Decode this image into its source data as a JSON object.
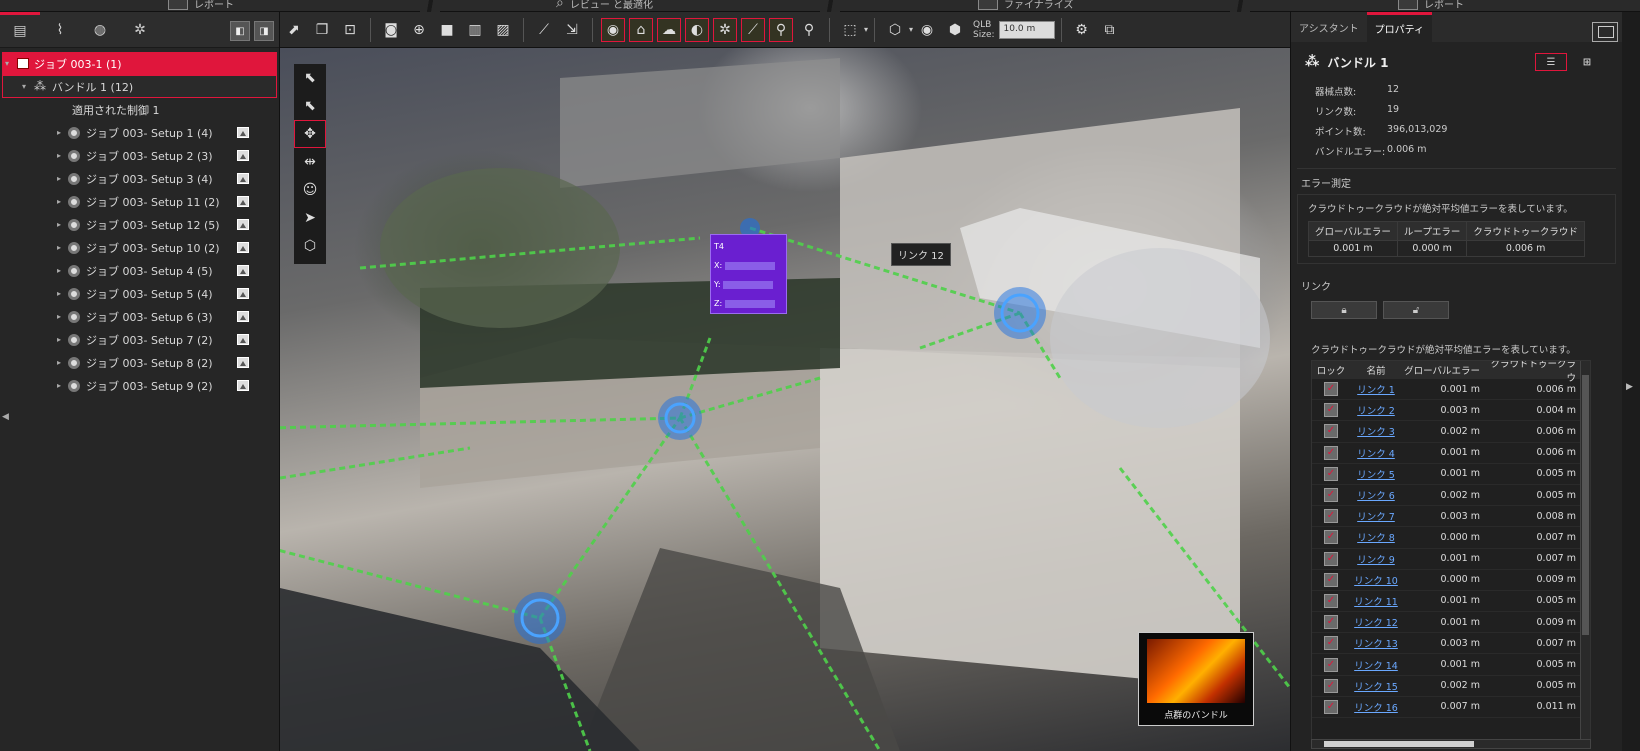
{
  "ribbon": {
    "items": [
      {
        "label": "レポート"
      },
      {
        "label": "レビュー と最適化"
      },
      {
        "label": "ファイナライズ"
      },
      {
        "label": "レポート"
      }
    ]
  },
  "left_panel": {
    "tree": {
      "job": {
        "label": "ジョブ 003-1 (1)"
      },
      "bundle": {
        "label": "バンドル 1 (12)"
      },
      "constraints": {
        "label": "適用された制御 1"
      },
      "setups": [
        {
          "label": "ジョブ 003- Setup 1 (4)"
        },
        {
          "label": "ジョブ 003- Setup 2 (3)"
        },
        {
          "label": "ジョブ 003- Setup 3 (4)"
        },
        {
          "label": "ジョブ 003- Setup 11 (2)"
        },
        {
          "label": "ジョブ 003- Setup 12 (5)"
        },
        {
          "label": "ジョブ 003- Setup 10 (2)"
        },
        {
          "label": "ジョブ 003- Setup 4 (5)"
        },
        {
          "label": "ジョブ 003- Setup 5 (4)"
        },
        {
          "label": "ジョブ 003- Setup 6 (3)"
        },
        {
          "label": "ジョブ 003- Setup 7 (2)"
        },
        {
          "label": "ジョブ 003- Setup 8 (2)"
        },
        {
          "label": "ジョブ 003- Setup 9 (2)"
        }
      ]
    }
  },
  "toolbar": {
    "qlb_label_1": "QLB",
    "qlb_label_2": "Size:",
    "qlb_value": "10.0 m"
  },
  "viewport": {
    "target_card": {
      "title": "T4",
      "x_label": "X:",
      "y_label": "Y:",
      "z_label": "Z:"
    },
    "link_tooltip": "リンク 12",
    "thumbnail_label": "点群のバンドル"
  },
  "right_panel": {
    "tabs": [
      {
        "label": "アシスタント"
      },
      {
        "label": "プロパティ"
      }
    ],
    "bundle_title": "バンドル 1",
    "properties": [
      {
        "key": "器械点数:",
        "value": "12"
      },
      {
        "key": "リンク数:",
        "value": "19"
      },
      {
        "key": "ポイント数:",
        "value": "396,013,029"
      },
      {
        "key": "バンドルエラー:",
        "value": "0.006 m"
      }
    ],
    "error_section": {
      "title": "エラー測定",
      "note": "クラウドトゥークラウドが絶対平均値エラーを表しています。",
      "headers": [
        "グローバルエラー",
        "ループエラー",
        "クラウドトゥークラウド"
      ],
      "values": [
        "0.001 m",
        "0.000 m",
        "0.006 m"
      ]
    },
    "links_section": {
      "title": "リンク",
      "note": "クラウドトゥークラウドが絶対平均値エラーを表しています。",
      "headers": [
        "ロック",
        "名前",
        "グローバルエラー",
        "クラウドトゥークラウ"
      ],
      "rows": [
        {
          "name": "リンク 1",
          "global": "0.001 m",
          "c2c": "0.006 m"
        },
        {
          "name": "リンク 2",
          "global": "0.003 m",
          "c2c": "0.004 m"
        },
        {
          "name": "リンク 3",
          "global": "0.002 m",
          "c2c": "0.006 m"
        },
        {
          "name": "リンク 4",
          "global": "0.001 m",
          "c2c": "0.006 m"
        },
        {
          "name": "リンク 5",
          "global": "0.001 m",
          "c2c": "0.005 m"
        },
        {
          "name": "リンク 6",
          "global": "0.002 m",
          "c2c": "0.005 m"
        },
        {
          "name": "リンク 7",
          "global": "0.003 m",
          "c2c": "0.008 m"
        },
        {
          "name": "リンク 8",
          "global": "0.000 m",
          "c2c": "0.007 m"
        },
        {
          "name": "リンク 9",
          "global": "0.001 m",
          "c2c": "0.007 m"
        },
        {
          "name": "リンク 10",
          "global": "0.000 m",
          "c2c": "0.009 m"
        },
        {
          "name": "リンク 11",
          "global": "0.001 m",
          "c2c": "0.005 m"
        },
        {
          "name": "リンク 12",
          "global": "0.001 m",
          "c2c": "0.009 m"
        },
        {
          "name": "リンク 13",
          "global": "0.003 m",
          "c2c": "0.007 m"
        },
        {
          "name": "リンク 14",
          "global": "0.001 m",
          "c2c": "0.005 m"
        },
        {
          "name": "リンク 15",
          "global": "0.002 m",
          "c2c": "0.005 m"
        },
        {
          "name": "リンク 16",
          "global": "0.007 m",
          "c2c": "0.011 m"
        }
      ]
    }
  },
  "colors": {
    "accent": "#e0163c",
    "link": "#6aa8ff",
    "setup_blue": "#1e6fe0",
    "link_line": "#4fd14a"
  }
}
